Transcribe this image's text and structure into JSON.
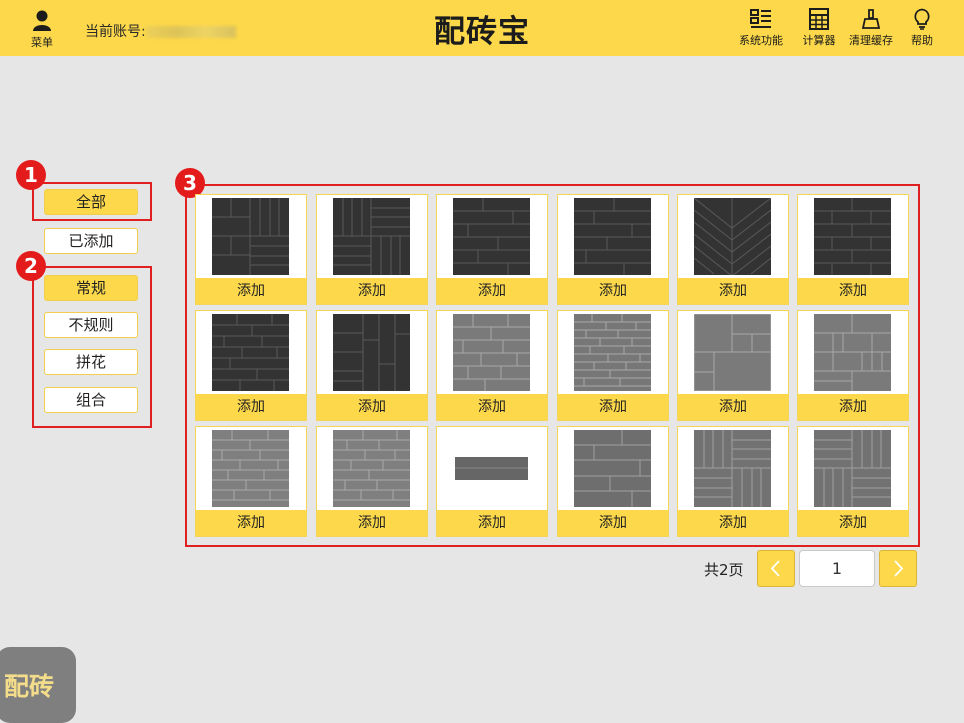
{
  "header": {
    "menu_label": "菜单",
    "account_label": "当前账号:",
    "title": "配砖宝",
    "buttons": [
      {
        "label": "系统功能",
        "icon": "grid-list-icon"
      },
      {
        "label": "计算器",
        "icon": "calculator-icon"
      },
      {
        "label": "清理缓存",
        "icon": "broom-icon"
      },
      {
        "label": "帮助",
        "icon": "lightbulb-icon"
      }
    ]
  },
  "sidebar": {
    "filter_all": "全部",
    "filter_added": "已添加",
    "categories": [
      "常规",
      "不规则",
      "拼花",
      "组合"
    ]
  },
  "annotations": [
    "1",
    "2",
    "3"
  ],
  "tiles": {
    "add_label": "添加",
    "items": [
      {
        "pattern": "herringbone-dark"
      },
      {
        "pattern": "basket-dark"
      },
      {
        "pattern": "running-bond-dark"
      },
      {
        "pattern": "running-bond-dark-2"
      },
      {
        "pattern": "chevron-dark"
      },
      {
        "pattern": "running-bond-dark-3"
      },
      {
        "pattern": "stagger-dark"
      },
      {
        "pattern": "herringbone-dark-2"
      },
      {
        "pattern": "brick-grey"
      },
      {
        "pattern": "small-brick-grey"
      },
      {
        "pattern": "versailles-grey"
      },
      {
        "pattern": "mixed-grey"
      },
      {
        "pattern": "brick-grey-2"
      },
      {
        "pattern": "brick-grey-3"
      },
      {
        "pattern": "single-plank"
      },
      {
        "pattern": "long-plank-grey"
      },
      {
        "pattern": "basket-grey"
      },
      {
        "pattern": "basket-grey-2"
      }
    ]
  },
  "pager": {
    "total_text": "共2页",
    "current_page": "1"
  },
  "floater_label": "配砖",
  "colors": {
    "accent": "#fcd84a",
    "highlight_red": "#e02020",
    "background": "#e6e6e6"
  }
}
